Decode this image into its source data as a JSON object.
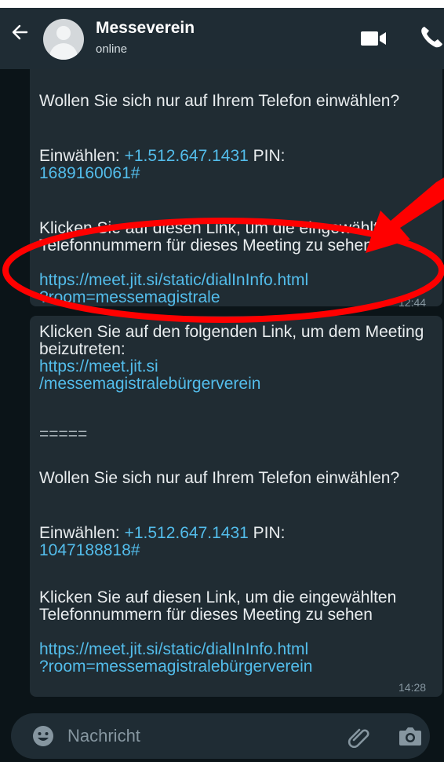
{
  "header": {
    "contact_name": "Messeverein",
    "status": "online",
    "icons": [
      "back-arrow-icon",
      "avatar-placeholder",
      "video-call-icon",
      "voice-call-icon"
    ]
  },
  "messages": [
    {
      "intro": "Wollen Sie sich nur auf Ihrem Telefon einwählen?",
      "dial_label": "Einwählen: ",
      "dial_number": "+1.512.647.1431",
      "pin_label": " PIN:",
      "pin": "1689160061#",
      "link_text": "Klicken Sie auf diesen Link, um die eingewählten Telefonnummern für dieses Meeting zu sehen",
      "url_line1": "https://meet.jit.si/static/dialInInfo.html",
      "url_line2": "?room=messemagistrale",
      "time": "12:44"
    },
    {
      "join_text": "Klicken Sie auf den folgenden Link, um dem Meeting beizutreten:",
      "join_url_line1": "https://meet.jit.si",
      "join_url_line2": "/messemagistralebürgerverein",
      "separator": "=====",
      "intro": "Wollen Sie sich nur auf Ihrem Telefon einwählen?",
      "dial_label": "Einwählen: ",
      "dial_number": "+1.512.647.1431",
      "pin_label": " PIN:",
      "pin": "1047188818#",
      "link_text": "Klicken Sie auf diesen Link, um die eingewählten Telefonnummern für dieses Meeting zu sehen",
      "url_line1": "https://meet.jit.si/static/dialInInfo.html",
      "url_line2": "?room=messemagistralebürgerverein",
      "time": "14:28"
    }
  ],
  "composer": {
    "placeholder": "Nachricht",
    "icons": [
      "emoji-icon",
      "attach-icon",
      "camera-icon"
    ]
  },
  "annotation": {
    "color": "#ff0000",
    "shapes": [
      "red-ellipse-highlight",
      "red-arrow"
    ]
  }
}
